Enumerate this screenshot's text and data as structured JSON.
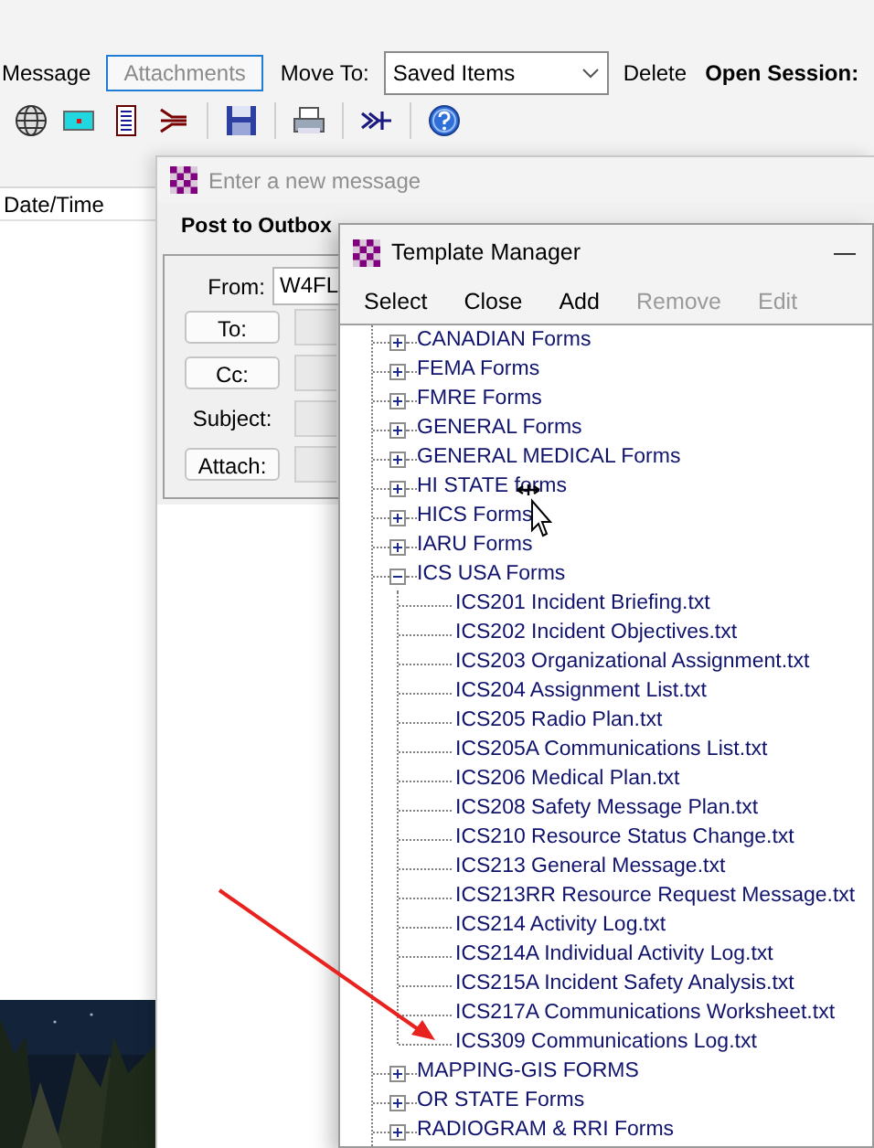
{
  "main": {
    "menu": [
      {
        "label": "Message",
        "kind": "text"
      },
      {
        "label": "Attachments",
        "kind": "button"
      },
      {
        "label": "Move To:",
        "kind": "text"
      },
      {
        "label": "Saved Items",
        "kind": "dropdown"
      },
      {
        "label": "Delete",
        "kind": "text"
      },
      {
        "label": "Open Session:",
        "kind": "heading"
      }
    ],
    "list": {
      "columns": [
        "Date/Time"
      ]
    }
  },
  "message_window": {
    "title": "Enter a new message",
    "active": false,
    "toolbar": [
      "Post to Outbox"
    ],
    "from": {
      "label": "From:",
      "value": "W4FL"
    },
    "fields": [
      {
        "label": "To:",
        "kind": "button"
      },
      {
        "label": "Cc:",
        "kind": "button"
      },
      {
        "label": "Subject:",
        "kind": "label"
      },
      {
        "label": "Attach:",
        "kind": "button"
      }
    ]
  },
  "template_manager": {
    "title": "Template Manager",
    "minimize": "—",
    "menu": [
      {
        "label": "Select",
        "disabled": false
      },
      {
        "label": "Close",
        "disabled": false
      },
      {
        "label": "Add",
        "disabled": false
      },
      {
        "label": "Remove",
        "disabled": true
      },
      {
        "label": "Edit",
        "disabled": true
      }
    ],
    "tree": [
      {
        "label": "CANADIAN Forms",
        "expanded": false
      },
      {
        "label": "FEMA Forms",
        "expanded": false
      },
      {
        "label": "FMRE Forms",
        "expanded": false
      },
      {
        "label": "GENERAL Forms",
        "expanded": false
      },
      {
        "label": "GENERAL MEDICAL Forms",
        "expanded": false
      },
      {
        "label": "HI STATE forms",
        "expanded": false
      },
      {
        "label": "HICS Forms",
        "expanded": false
      },
      {
        "label": "IARU Forms",
        "expanded": false
      },
      {
        "label": "ICS USA Forms",
        "expanded": true,
        "children": [
          {
            "label": "ICS201 Incident Briefing.txt"
          },
          {
            "label": "ICS202 Incident Objectives.txt"
          },
          {
            "label": "ICS203 Organizational Assignment.txt"
          },
          {
            "label": "ICS204 Assignment List.txt"
          },
          {
            "label": "ICS205 Radio Plan.txt"
          },
          {
            "label": "ICS205A Communications List.txt"
          },
          {
            "label": "ICS206 Medical Plan.txt"
          },
          {
            "label": "ICS208 Safety Message Plan.txt"
          },
          {
            "label": "ICS210 Resource Status Change.txt"
          },
          {
            "label": "ICS213 General Message.txt"
          },
          {
            "label": "ICS213RR Resource Request Message.txt"
          },
          {
            "label": "ICS214 Activity Log.txt"
          },
          {
            "label": "ICS214A Individual Activity Log.txt"
          },
          {
            "label": "ICS215A Incident Safety Analysis.txt"
          },
          {
            "label": "ICS217A Communications Worksheet.txt"
          },
          {
            "label": "ICS309 Communications Log.txt"
          }
        ]
      },
      {
        "label": "MAPPING-GIS FORMS",
        "expanded": false
      },
      {
        "label": "OR STATE Forms",
        "expanded": false
      },
      {
        "label": "RADIOGRAM & RRI Forms",
        "expanded": false
      }
    ]
  }
}
